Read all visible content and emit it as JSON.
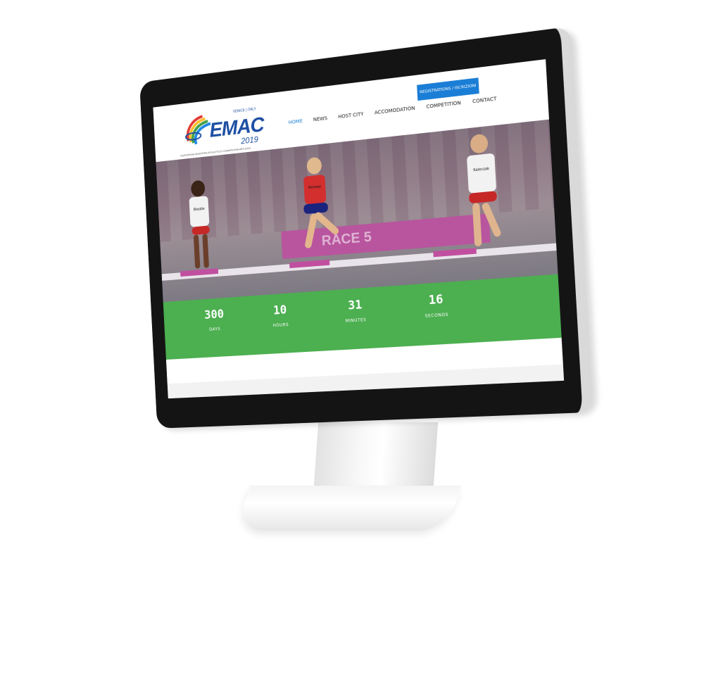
{
  "site": {
    "logo_text": "EMAC",
    "logo_year": "2019",
    "logo_tag": "VENICE | ITALY",
    "logo_subline": "EUROPEAN MASTERS ATHLETICS CHAMPIONSHIPS 2019"
  },
  "nav": {
    "items": [
      {
        "label": "HOME",
        "active": true
      },
      {
        "label": "NEWS",
        "active": false
      },
      {
        "label": "HOST CITY",
        "active": false
      },
      {
        "label": "ACCOMODATION",
        "active": false
      },
      {
        "label": "COMPETITION",
        "active": false
      },
      {
        "label": "CONTACT",
        "active": false
      }
    ],
    "register_label": "REGISTRATIONS / ISCRIZIONI"
  },
  "hero": {
    "banner_text": "RACE 5",
    "athletes": [
      {
        "bib": "Bladde"
      },
      {
        "bib": "Norway"
      },
      {
        "bib": "Kaleczak"
      }
    ],
    "colors": {
      "banner": "#b8559e",
      "accent_blue": "#1b7ed6"
    }
  },
  "countdown": {
    "items": [
      {
        "value": "300",
        "label": "DAYS"
      },
      {
        "value": "10",
        "label": "HOURS"
      },
      {
        "value": "31",
        "label": "MINUTES"
      },
      {
        "value": "16",
        "label": "SECONDS"
      }
    ],
    "color": "#4caf50"
  }
}
